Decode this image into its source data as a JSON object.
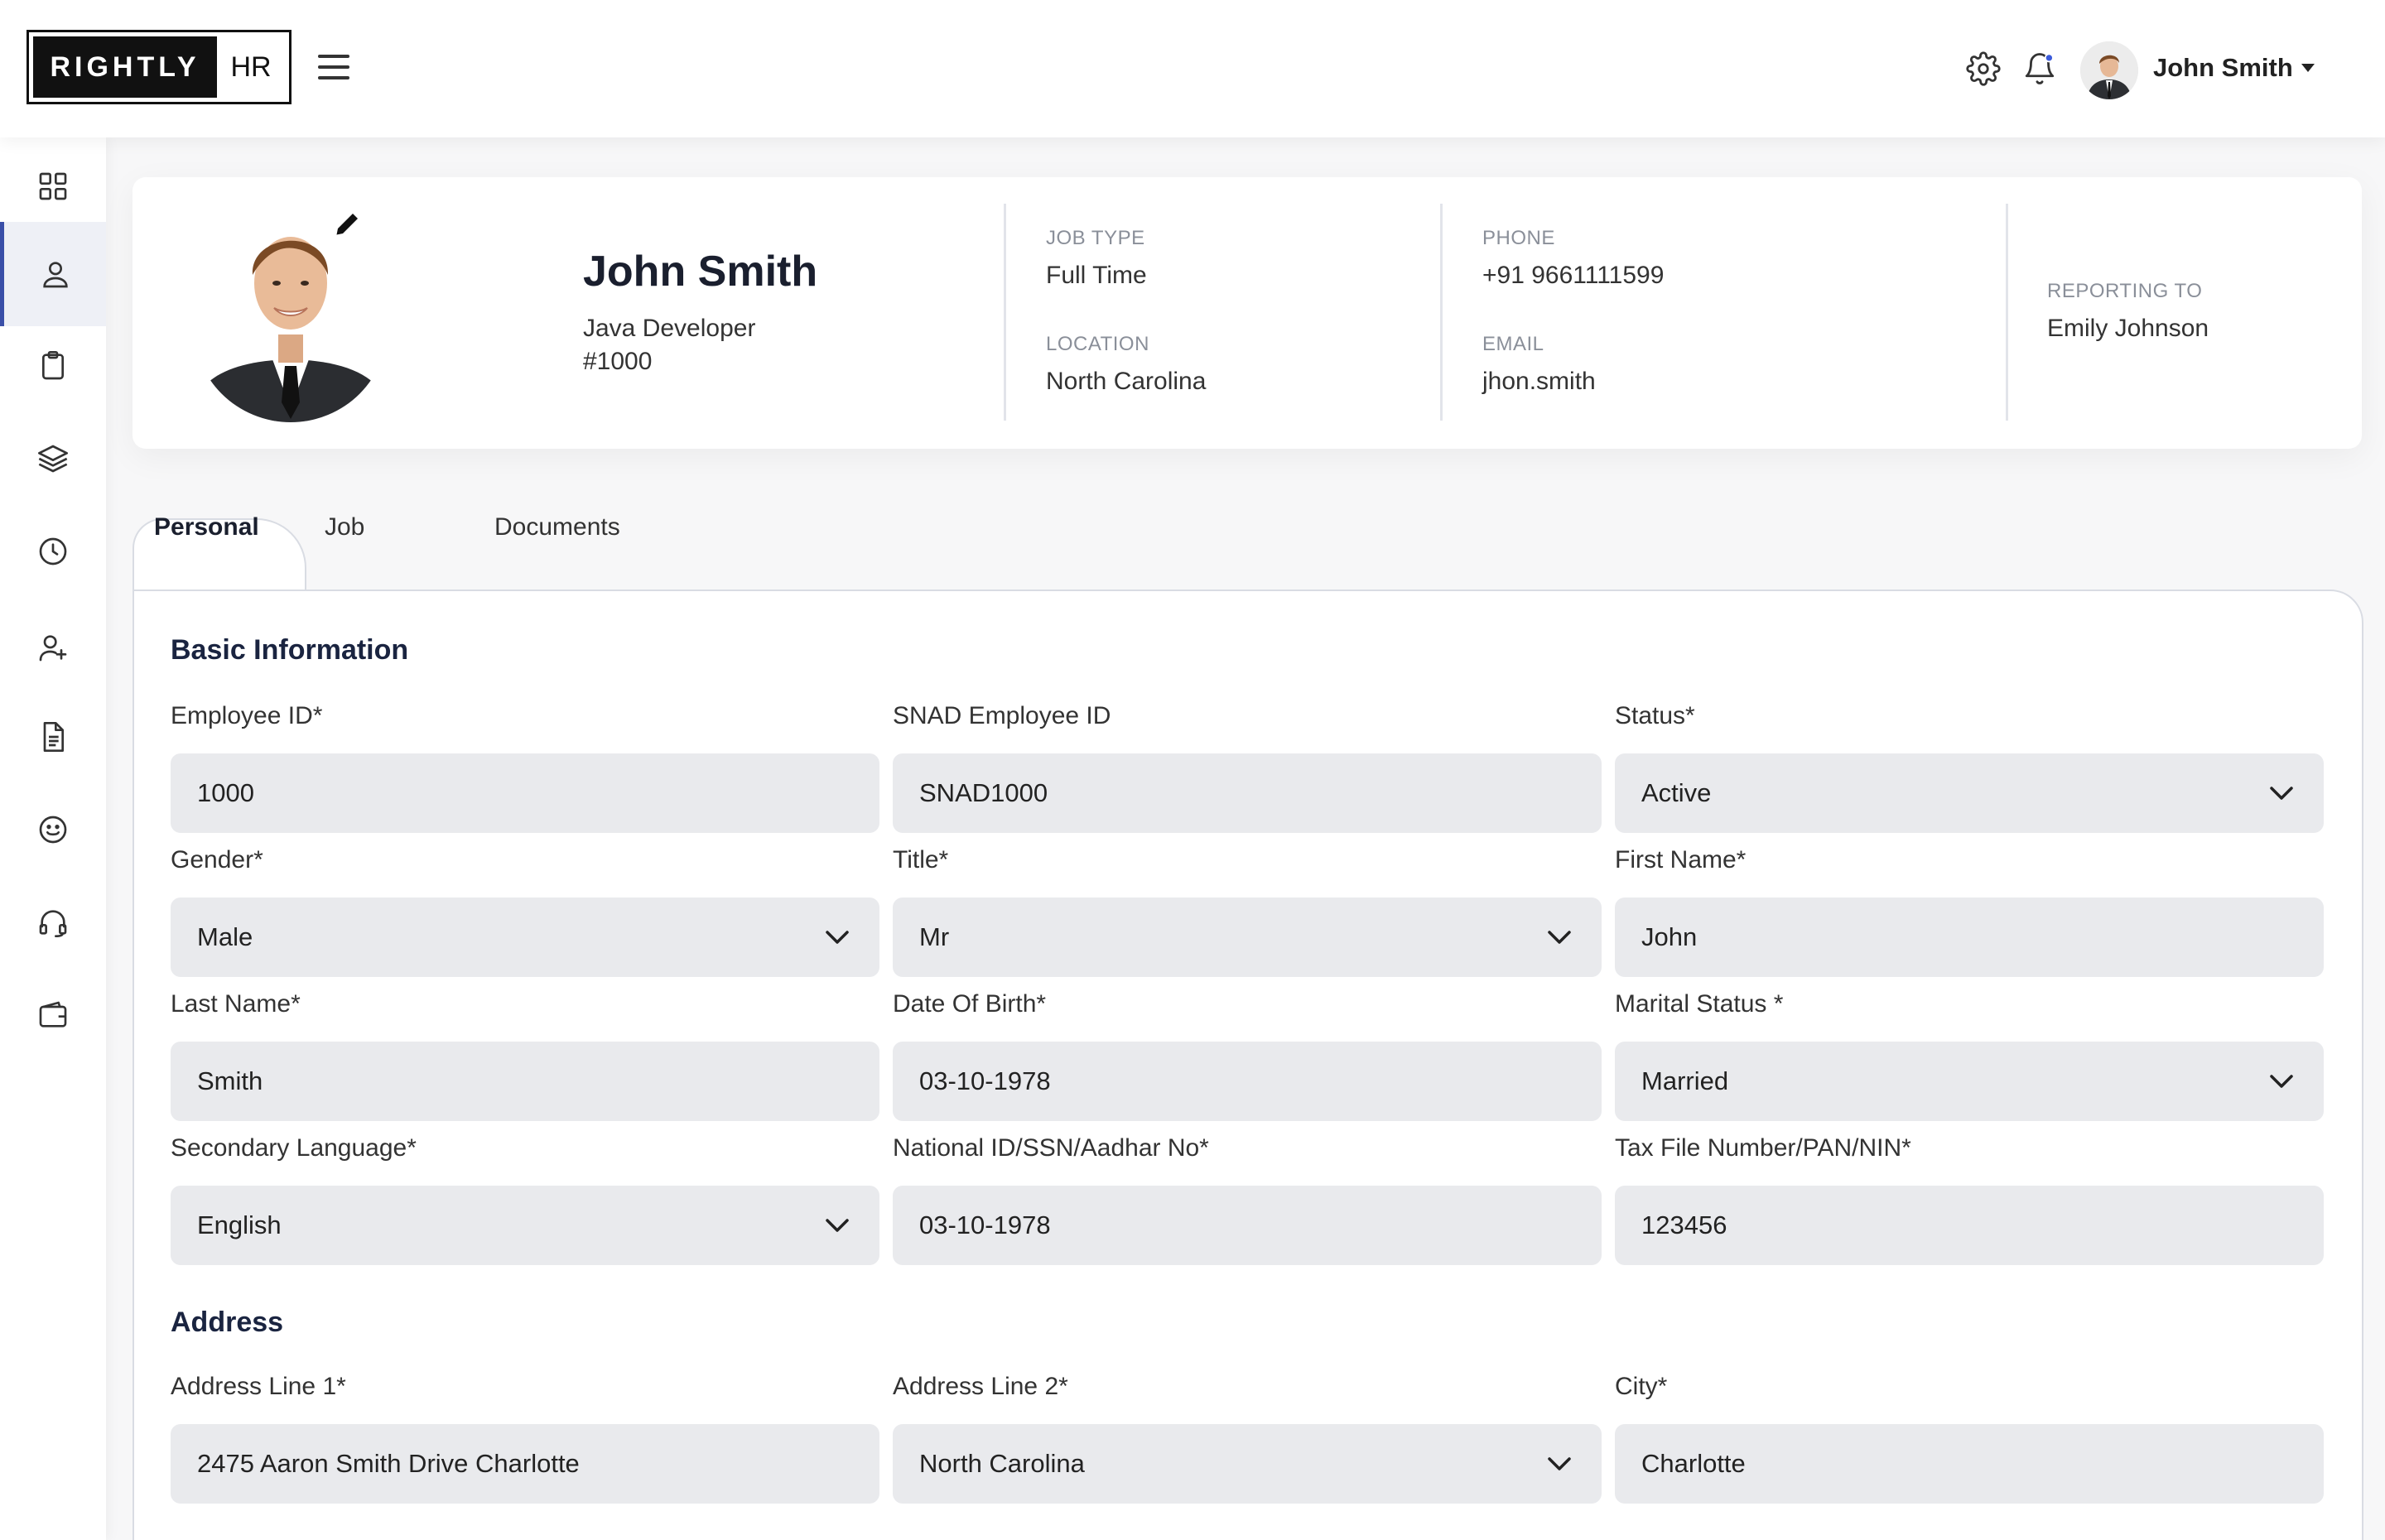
{
  "header": {
    "logo_left": "RIGHTLY",
    "logo_right": "HR",
    "user_name": "John Smith",
    "notification_dot_color": "#3b5bdb"
  },
  "sidebar": {
    "items": [
      {
        "icon": "dashboard-grid-icon",
        "active": false
      },
      {
        "icon": "user-icon",
        "active": true
      },
      {
        "icon": "clipboard-icon",
        "active": false
      },
      {
        "icon": "layers-icon",
        "active": false
      },
      {
        "icon": "clock-icon",
        "active": false
      },
      {
        "icon": "add-user-icon",
        "active": false
      },
      {
        "icon": "document-icon",
        "active": false
      },
      {
        "icon": "smile-icon",
        "active": false
      },
      {
        "icon": "headset-icon",
        "active": false
      },
      {
        "icon": "wallet-icon",
        "active": false
      }
    ]
  },
  "profile": {
    "name": "John Smith",
    "role": "Java Developer",
    "id": "#1000",
    "job_type_label": "JOB TYPE",
    "job_type": "Full Time",
    "location_label": "LOCATION",
    "location": "North Carolina",
    "phone_label": "PHONE",
    "phone": "+91 9661111599",
    "email_label": "EMAIL",
    "email": "jhon.smith",
    "reporting_label": "REPORTING TO",
    "reporting_to": "Emily Johnson"
  },
  "tabs": [
    {
      "label": "Personal",
      "active": true
    },
    {
      "label": "Job",
      "active": false
    },
    {
      "label": "Documents",
      "active": false
    }
  ],
  "basic": {
    "title": "Basic Information",
    "employee_id": {
      "label": "Employee ID*",
      "value": "1000"
    },
    "snad_id": {
      "label": "SNAD Employee ID",
      "value": "SNAD1000"
    },
    "status": {
      "label": "Status*",
      "value": "Active"
    },
    "gender": {
      "label": "Gender*",
      "value": "Male"
    },
    "title_field": {
      "label": "Title*",
      "value": "Mr"
    },
    "first_name": {
      "label": "First Name*",
      "value": "John"
    },
    "last_name": {
      "label": "Last Name*",
      "value": "Smith"
    },
    "dob": {
      "label": "Date Of Birth*",
      "value": "03-10-1978"
    },
    "marital": {
      "label": "Marital Status *",
      "value": "Married"
    },
    "language": {
      "label": "Secondary Language*",
      "value": "English"
    },
    "national_id": {
      "label": "National ID/SSN/Aadhar No*",
      "value": "03-10-1978"
    },
    "tax": {
      "label": "Tax File Number/PAN/NIN*",
      "value": "123456"
    }
  },
  "address": {
    "title": "Address",
    "line1": {
      "label": "Address Line 1*",
      "value": "2475 Aaron Smith Drive Charlotte"
    },
    "line2": {
      "label": "Address Line 2*",
      "value": "North Carolina"
    },
    "city": {
      "label": "City*",
      "value": "Charlotte"
    }
  }
}
